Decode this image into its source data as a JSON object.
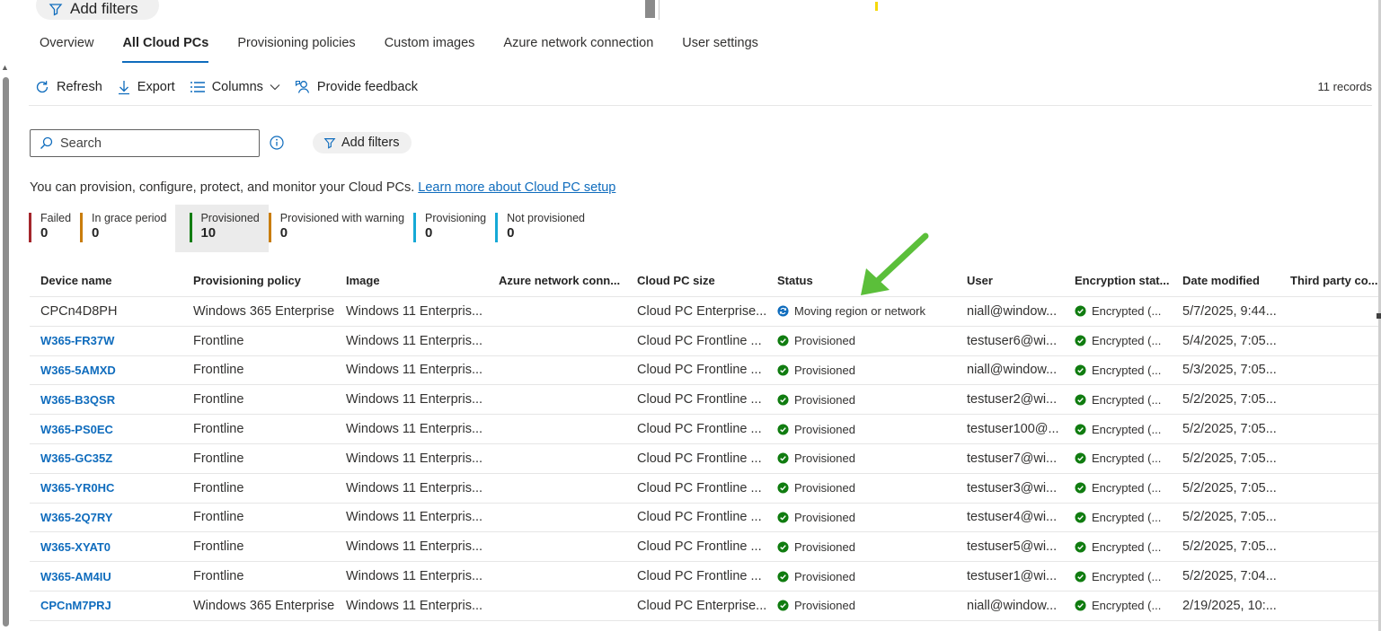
{
  "top": {
    "add_filters_label": "Add filters"
  },
  "tabs": [
    {
      "label": "Overview",
      "active": false
    },
    {
      "label": "All Cloud PCs",
      "active": true
    },
    {
      "label": "Provisioning policies",
      "active": false
    },
    {
      "label": "Custom images",
      "active": false
    },
    {
      "label": "Azure network connection",
      "active": false
    },
    {
      "label": "User settings",
      "active": false
    }
  ],
  "toolbar": {
    "refresh": "Refresh",
    "export": "Export",
    "columns": "Columns",
    "feedback": "Provide feedback",
    "records": "11 records"
  },
  "search": {
    "placeholder": "Search"
  },
  "filters": {
    "label": "Add filters"
  },
  "description": {
    "text": "You can provision, configure, protect, and monitor your Cloud PCs.",
    "link": "Learn more about Cloud PC setup"
  },
  "status_cards": [
    {
      "label": "Failed",
      "count": "0",
      "color": "#a4262c"
    },
    {
      "label": "In grace period",
      "count": "0",
      "color": "#c97d0c"
    },
    {
      "label": "Provisioned",
      "count": "10",
      "color": "#107c10"
    },
    {
      "label": "Provisioned with warning",
      "count": "0",
      "color": "#c97d0c"
    },
    {
      "label": "Provisioning",
      "count": "0",
      "color": "#15a9d6"
    },
    {
      "label": "Not provisioned",
      "count": "0",
      "color": "#15a9d6"
    }
  ],
  "table": {
    "columns": [
      "Device name",
      "Provisioning policy",
      "Image",
      "Azure network conn...",
      "Cloud PC size",
      "Status",
      "User",
      "Encryption stat...",
      "Date modified",
      "Third party co..."
    ],
    "rows": [
      {
        "device": "CPCn4D8PH",
        "policy": "Windows 365 Enterprise",
        "image": "Windows 11 Enterpris...",
        "network": "",
        "size": "Cloud PC Enterprise...",
        "status": "Moving region or network",
        "status_kind": "moving",
        "user": "niall@window...",
        "encryption": "Encrypted (...",
        "date": "5/7/2025, 9:44...",
        "third": ""
      },
      {
        "device": "W365-FR37W",
        "policy": "Frontline",
        "image": "Windows 11 Enterpris...",
        "network": "",
        "size": "Cloud PC Frontline ...",
        "status": "Provisioned",
        "status_kind": "ok",
        "user": "testuser6@wi...",
        "encryption": "Encrypted (...",
        "date": "5/4/2025, 7:05...",
        "third": ""
      },
      {
        "device": "W365-5AMXD",
        "policy": "Frontline",
        "image": "Windows 11 Enterpris...",
        "network": "",
        "size": "Cloud PC Frontline ...",
        "status": "Provisioned",
        "status_kind": "ok",
        "user": "niall@window...",
        "encryption": "Encrypted (...",
        "date": "5/3/2025, 7:05...",
        "third": ""
      },
      {
        "device": "W365-B3QSR",
        "policy": "Frontline",
        "image": "Windows 11 Enterpris...",
        "network": "",
        "size": "Cloud PC Frontline ...",
        "status": "Provisioned",
        "status_kind": "ok",
        "user": "testuser2@wi...",
        "encryption": "Encrypted (...",
        "date": "5/2/2025, 7:05...",
        "third": ""
      },
      {
        "device": "W365-PS0EC",
        "policy": "Frontline",
        "image": "Windows 11 Enterpris...",
        "network": "",
        "size": "Cloud PC Frontline ...",
        "status": "Provisioned",
        "status_kind": "ok",
        "user": "testuser100@...",
        "encryption": "Encrypted (...",
        "date": "5/2/2025, 7:05...",
        "third": ""
      },
      {
        "device": "W365-GC35Z",
        "policy": "Frontline",
        "image": "Windows 11 Enterpris...",
        "network": "",
        "size": "Cloud PC Frontline ...",
        "status": "Provisioned",
        "status_kind": "ok",
        "user": "testuser7@wi...",
        "encryption": "Encrypted (...",
        "date": "5/2/2025, 7:05...",
        "third": ""
      },
      {
        "device": "W365-YR0HC",
        "policy": "Frontline",
        "image": "Windows 11 Enterpris...",
        "network": "",
        "size": "Cloud PC Frontline ...",
        "status": "Provisioned",
        "status_kind": "ok",
        "user": "testuser3@wi...",
        "encryption": "Encrypted (...",
        "date": "5/2/2025, 7:05...",
        "third": ""
      },
      {
        "device": "W365-2Q7RY",
        "policy": "Frontline",
        "image": "Windows 11 Enterpris...",
        "network": "",
        "size": "Cloud PC Frontline ...",
        "status": "Provisioned",
        "status_kind": "ok",
        "user": "testuser4@wi...",
        "encryption": "Encrypted (...",
        "date": "5/2/2025, 7:05...",
        "third": ""
      },
      {
        "device": "W365-XYAT0",
        "policy": "Frontline",
        "image": "Windows 11 Enterpris...",
        "network": "",
        "size": "Cloud PC Frontline ...",
        "status": "Provisioned",
        "status_kind": "ok",
        "user": "testuser5@wi...",
        "encryption": "Encrypted (...",
        "date": "5/2/2025, 7:05...",
        "third": ""
      },
      {
        "device": "W365-AM4IU",
        "policy": "Frontline",
        "image": "Windows 11 Enterpris...",
        "network": "",
        "size": "Cloud PC Frontline ...",
        "status": "Provisioned",
        "status_kind": "ok",
        "user": "testuser1@wi...",
        "encryption": "Encrypted (...",
        "date": "5/2/2025, 7:04...",
        "third": ""
      },
      {
        "device": "CPCnM7PRJ",
        "policy": "Windows 365 Enterprise",
        "image": "Windows 11 Enterpris...",
        "network": "",
        "size": "Cloud PC Enterprise...",
        "status": "Provisioned",
        "status_kind": "ok",
        "user": "niall@window...",
        "encryption": "Encrypted (...",
        "date": "2/19/2025, 10:...",
        "third": ""
      }
    ]
  },
  "colors": {
    "accent": "#0f6cbd",
    "success": "#107c10",
    "annotation": "#5bbf3a"
  },
  "icons": {
    "refresh": "refresh-icon",
    "export": "download-icon",
    "columns": "columns-icon",
    "feedback": "feedback-icon",
    "search": "search-icon",
    "info": "info-icon",
    "filter": "filter-icon",
    "provisioned": "check-circle-icon",
    "moving": "sync-icon"
  }
}
